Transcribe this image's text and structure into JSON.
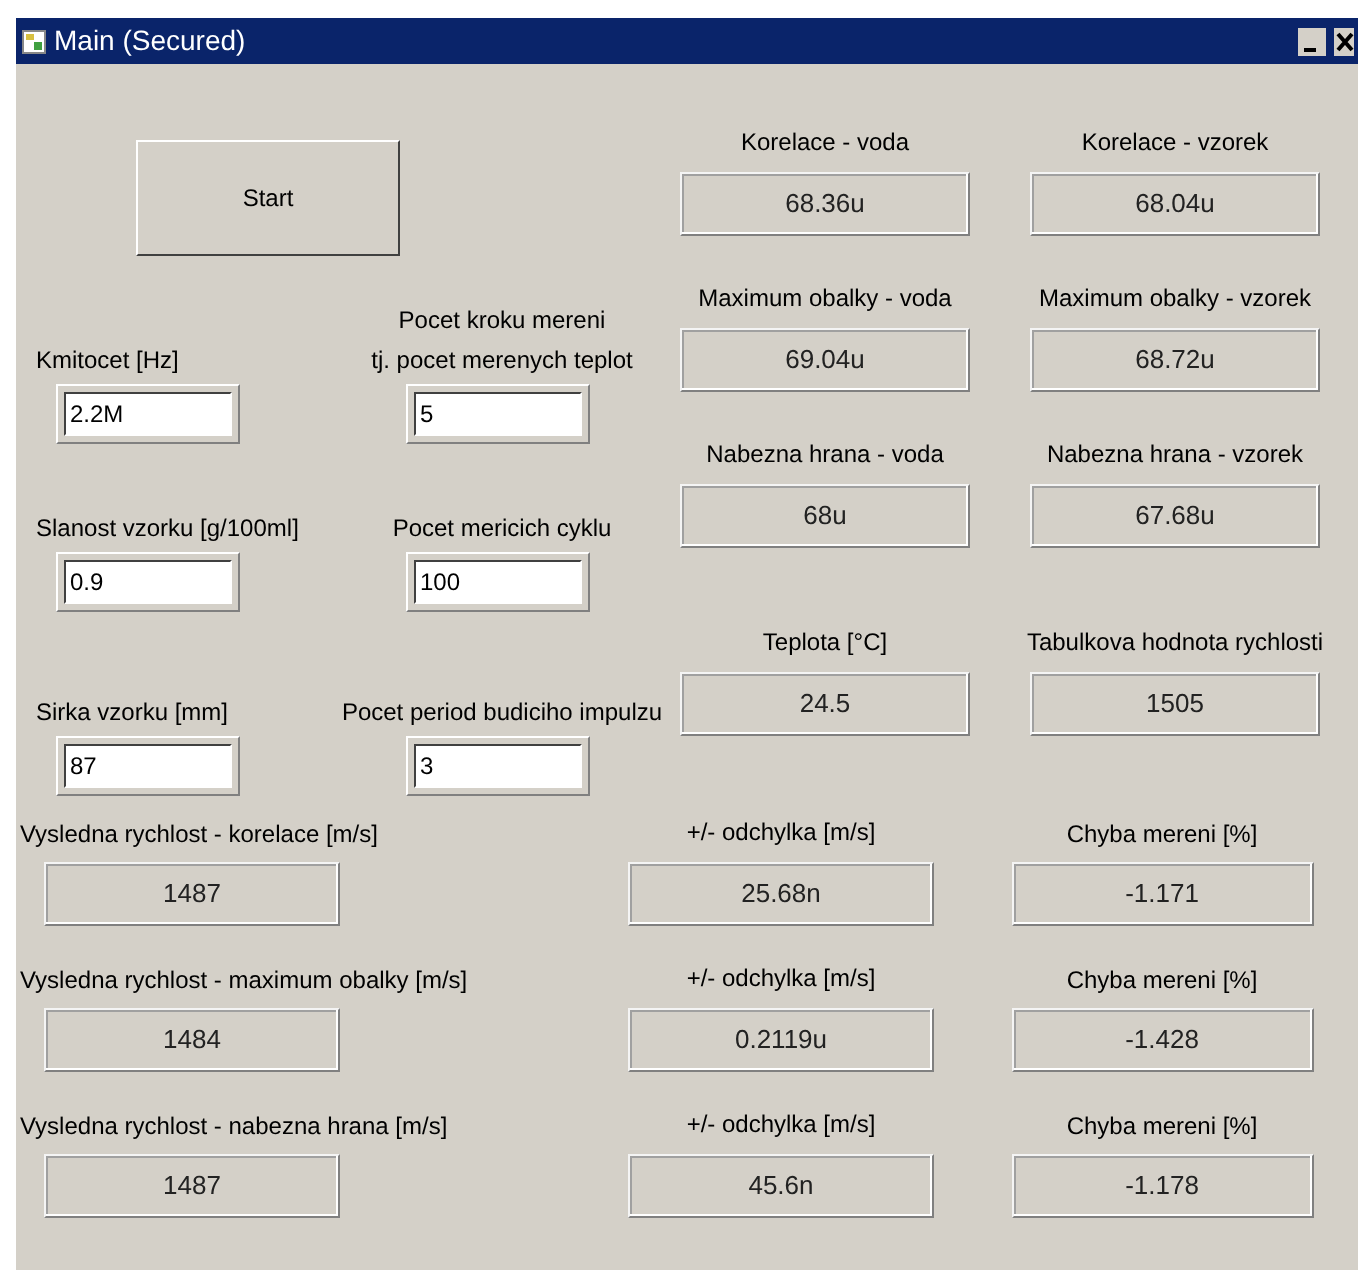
{
  "window": {
    "title": "Main (Secured)"
  },
  "start_button": {
    "label": "Start"
  },
  "inputs": [
    [
      {
        "label": "Kmitocet [Hz]",
        "value": "2.2M"
      },
      {
        "label": "Pocet kroku mereni\ntj. pocet merenych teplot",
        "value": "5"
      }
    ],
    [
      {
        "label": "Slanost vzorku [g/100ml]",
        "value": "0.9"
      },
      {
        "label": "Pocet mericich cyklu",
        "value": "100"
      }
    ],
    [
      {
        "label": "Sirka vzorku [mm]",
        "value": "87"
      },
      {
        "label": "Pocet period budiciho impulzu",
        "value": "3"
      }
    ]
  ],
  "displays": [
    [
      {
        "label": "Korelace - voda",
        "value": "68.36u"
      },
      {
        "label": "Korelace - vzorek",
        "value": "68.04u"
      }
    ],
    [
      {
        "label": "Maximum obalky - voda",
        "value": "69.04u"
      },
      {
        "label": "Maximum obalky - vzorek",
        "value": "68.72u"
      }
    ],
    [
      {
        "label": "Nabezna hrana - voda",
        "value": "68u"
      },
      {
        "label": "Nabezna hrana - vzorek",
        "value": "67.68u"
      }
    ],
    [
      {
        "label": "Teplota [°C]",
        "value": "24.5"
      },
      {
        "label": "Tabulkova hodnota rychlosti",
        "value": "1505"
      }
    ]
  ],
  "results": [
    {
      "speed_label": "Vysledna rychlost - korelace [m/s]",
      "speed": "1487",
      "deviation_label": "+/- odchylka [m/s]",
      "deviation": "25.68n",
      "error_label": "Chyba mereni [%]",
      "error": "-1.171"
    },
    {
      "speed_label": "Vysledna rychlost - maximum obalky [m/s]",
      "speed": "1484",
      "deviation_label": "+/- odchylka [m/s]",
      "deviation": "0.2119u",
      "error_label": "Chyba mereni [%]",
      "error": "-1.428"
    },
    {
      "speed_label": "Vysledna rychlost - nabezna hrana [m/s]",
      "speed": "1487",
      "deviation_label": "+/- odchylka [m/s]",
      "deviation": "45.6n",
      "error_label": "Chyba mereni [%]",
      "error": "-1.178"
    }
  ]
}
